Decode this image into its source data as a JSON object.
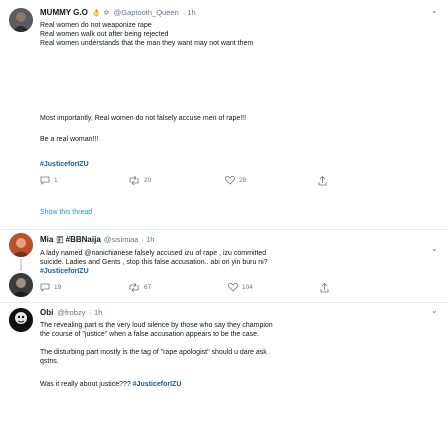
{
  "tweet1": {
    "name": "MUMMY G.O",
    "emoji": "👌 ✡",
    "handle": "@Gaptooth_Queen",
    "time": "· 1h",
    "lines": [
      "Real women do not weaponize rape",
      "Real women walk out after being rejected",
      "Real women understands that the man they want may not want them"
    ],
    "para2": "Most importantly, Real women do not falsely accuse men of rape!!!",
    "para3": "Be a real woman!!!",
    "hashtag": "#JusticeforIZU",
    "replies": "1",
    "retweets": "20",
    "likes": "28",
    "show_thread": "Show this thread"
  },
  "tweet2": {
    "name": "Mia",
    "badge": "🇫 #BBNaija",
    "handle": "@sisimiaa",
    "time": "· 1h",
    "lines": [
      "A lady named @nanichianese falsely accused izu of rape , izu committed",
      "suicide. Ladies and Gents , stop this false accusation.. abi ori yin buru ni?"
    ],
    "hashtag": "#JusticeforIZU",
    "replies": "19",
    "retweets": "67",
    "likes": "104"
  },
  "tweet3": {
    "name": "Obi",
    "handle": "@frobzy",
    "time": "· 1h",
    "lines": [
      "The revealing part is the very loud silence by those who say they champion",
      "the course of \"justice\" when a false accusation appears to be the case."
    ],
    "para2_lines": [
      "The disturbing part mostly is the tag of \"rape apologist\" should u dare ask",
      "qstns."
    ],
    "para3": "Was it really about justice???",
    "para3_tag": "#JusticeforIZU"
  },
  "colors": {
    "link": "#1b95e0",
    "hashtag": "#1a5f96",
    "muted": "#657786"
  }
}
